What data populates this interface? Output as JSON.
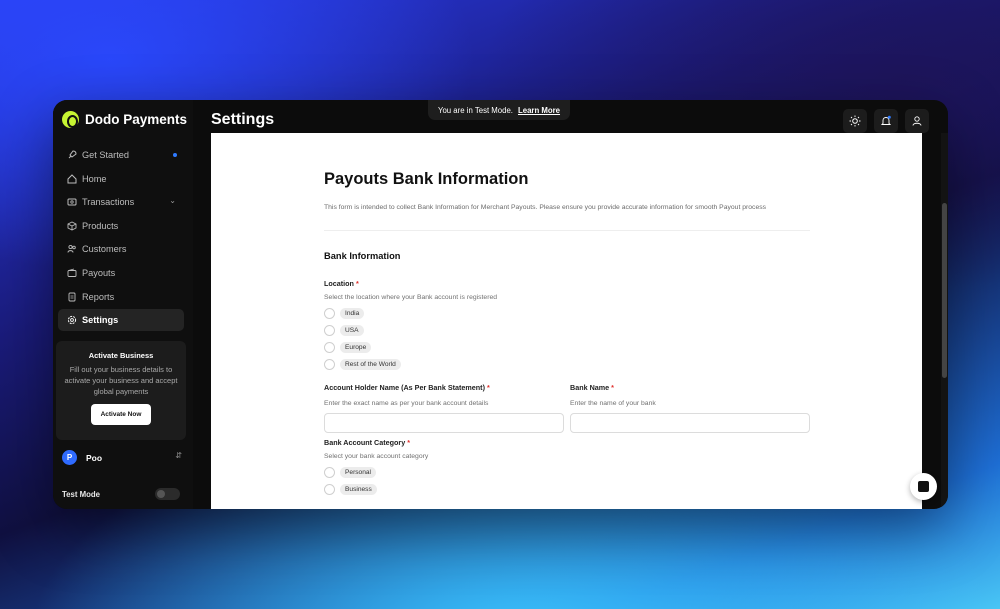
{
  "app": {
    "name": "Dodo Payments",
    "brand_color": "#c6f432",
    "accent": "#2f7bff"
  },
  "header": {
    "title": "Settings",
    "test_banner": {
      "text": "You are in Test Mode.",
      "link": "Learn More"
    }
  },
  "sidebar": {
    "items": [
      {
        "label": "Get Started",
        "icon": "rocket-icon"
      },
      {
        "label": "Home",
        "icon": "home-icon"
      },
      {
        "label": "Transactions",
        "icon": "transactions-icon"
      },
      {
        "label": "Products",
        "icon": "box-icon"
      },
      {
        "label": "Customers",
        "icon": "users-icon"
      },
      {
        "label": "Payouts",
        "icon": "wallet-icon"
      },
      {
        "label": "Reports",
        "icon": "report-icon"
      },
      {
        "label": "Settings",
        "icon": "gear-icon"
      }
    ],
    "activate_card": {
      "title": "Activate Business",
      "description": "Fill out your business details to activate your business and accept global payments",
      "button": "Activate Now"
    },
    "account": {
      "initial": "P",
      "name": "Poo"
    },
    "test_mode": {
      "label": "Test Mode",
      "enabled": false
    }
  },
  "form": {
    "title": "Payouts Bank Information",
    "intro": "This form is intended to collect Bank Information for Merchant Payouts. Please ensure you provide accurate information for smooth Payout process",
    "section": "Bank Information",
    "location": {
      "label": "Location",
      "hint": "Select the location where your Bank account is registered",
      "options": [
        "India",
        "USA",
        "Europe",
        "Rest of the World"
      ]
    },
    "account_holder": {
      "label": "Account Holder Name (As Per Bank Statement)",
      "hint": "Enter the exact name as per your bank account details",
      "value": ""
    },
    "bank_name": {
      "label": "Bank Name",
      "hint": "Enter the name of your bank",
      "value": ""
    },
    "account_category": {
      "label": "Bank Account Category",
      "hint": "Select your bank account category",
      "options": [
        "Personal",
        "Business"
      ]
    },
    "required_mark": "*"
  }
}
